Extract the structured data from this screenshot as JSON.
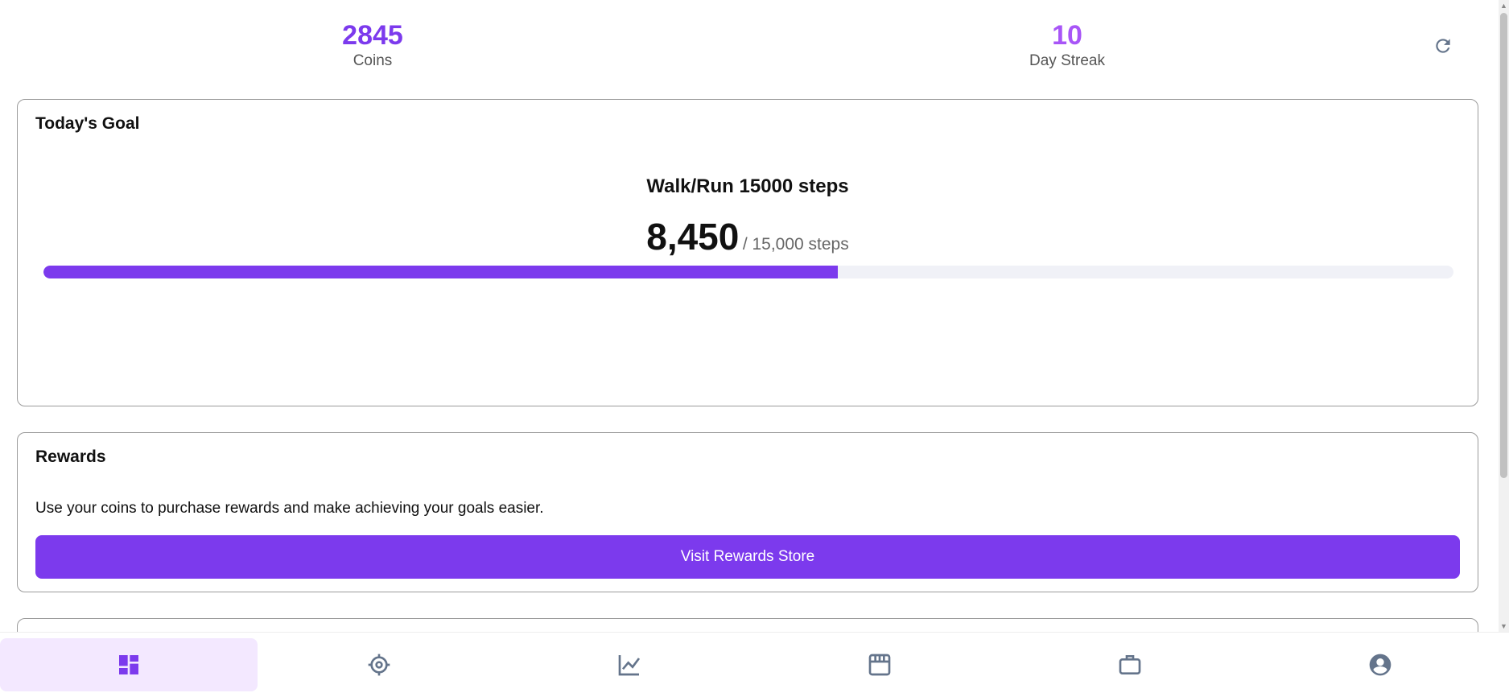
{
  "stats": {
    "coins": {
      "value": "2845",
      "label": "Coins"
    },
    "streak": {
      "value": "10",
      "label": "Day Streak"
    }
  },
  "goal": {
    "title": "Today's Goal",
    "name": "Walk/Run 15000 steps",
    "current": "8,450",
    "total_text": "/ 15,000 steps",
    "progress": 0.5633
  },
  "rewards": {
    "title": "Rewards",
    "description": "Use your coins to purchase rewards and make achieving your goals easier.",
    "button_label": "Visit Rewards Store"
  },
  "nav": {
    "items": [
      {
        "icon": "dashboard-icon",
        "active": true
      },
      {
        "icon": "crosshair-icon",
        "active": false
      },
      {
        "icon": "chart-icon",
        "active": false
      },
      {
        "icon": "store-icon",
        "active": false
      },
      {
        "icon": "briefcase-icon",
        "active": false
      },
      {
        "icon": "account-circle-icon",
        "active": false
      }
    ]
  },
  "colors": {
    "accent": "#7c3aed",
    "streak": "#a855f7",
    "icon_inactive": "#64748b",
    "nav_active_bg": "#f3e8ff"
  }
}
